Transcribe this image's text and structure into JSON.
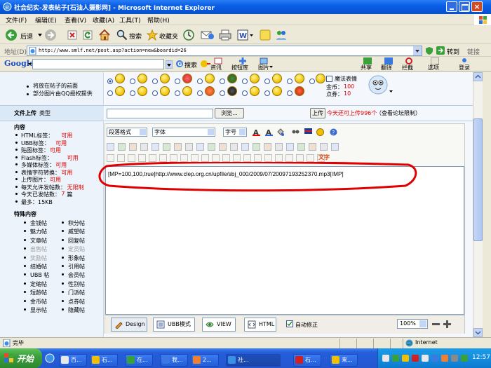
{
  "window": {
    "title": "社会纪实-发表帖子[石油人摄影网] - Microsoft Internet Explorer"
  },
  "menu": [
    "文件(F)",
    "编辑(E)",
    "查看(V)",
    "收藏(A)",
    "工具(T)",
    "帮助(H)"
  ],
  "toolbar": {
    "back": "后退",
    "search": "搜索",
    "favorites": "收藏夹"
  },
  "address": {
    "label": "地址(D)",
    "url": "http://www.smlf.net/post.asp?action=new&boardid=26",
    "go": "转到",
    "links": "链接"
  },
  "google": {
    "logo": "Google",
    "search": "搜索",
    "info": "资讯",
    "btn": "按钮库",
    "images": "图片",
    "share": "共享",
    "translate": "翻译",
    "block": "拦截",
    "options": "选项",
    "login": "登录"
  },
  "side_top": {
    "line1": "将放在帖子的前面",
    "line2": "部分图片由QQ授权提供"
  },
  "emoticon_opts": {
    "magic": "魔法表情",
    "coins_label": "金币：",
    "coins": "100",
    "points_label": "点券：",
    "points": "10"
  },
  "upload": {
    "label": "文件上传",
    "type": "类型",
    "browse": "浏览...",
    "upload_btn": "上传",
    "notice": "今天还可上传996个",
    "limit": "（查看论坛限制）"
  },
  "content": {
    "title": "内容",
    "items": [
      {
        "text": "HTML标签：",
        "value": "可用"
      },
      {
        "text": "UBB标签：",
        "value": "可用"
      },
      {
        "text": "贴图标签：",
        "value": "可用"
      },
      {
        "text": "Flash标签：",
        "value": "可用"
      },
      {
        "text": "多媒体标签：",
        "value": "可用"
      },
      {
        "text": "表情字符转换：",
        "value": "可用"
      },
      {
        "text": "上传图片：",
        "value": "可用"
      },
      {
        "text": "每天允许发帖数：",
        "value": "无限制"
      },
      {
        "text": "今天已发帖数：",
        "value": "7",
        "suffix": " 篇"
      },
      {
        "text": "最多：15KB",
        "value": ""
      }
    ]
  },
  "special": {
    "title": "特殊内容",
    "left": [
      "金钱帖",
      "魅力帖",
      "文章帖",
      "出售帖",
      "奖励帖",
      "结婚帖",
      "UBB 帖",
      "定缩帖",
      "短龄帖",
      "金币帖",
      "显示帖"
    ],
    "right": [
      "积分帖",
      "威望帖",
      "回复帖",
      "定员贴",
      "形象帖",
      "引用帖",
      "会员帖",
      "性别帖",
      "门派帖",
      "点券帖",
      "隐藏帖"
    ],
    "left_gray": [
      3,
      4
    ],
    "right_gray": [
      3
    ]
  },
  "editor": {
    "format": "段落格式",
    "font": "字体",
    "size": "字号",
    "body": "[MP=100,100,true]http://www.clep.org.cn/upfile/sbj_000/2009/07/20097193252370.mp3[/MP]",
    "text_label": "文字",
    "modes": {
      "design": "Design",
      "ubb": "UBB模式",
      "view": "VIEW",
      "html": "HTML",
      "auto": "自动修正"
    },
    "zoom": "100%"
  },
  "status": {
    "done": "完毕",
    "zone": "Internet"
  },
  "taskbar": {
    "start": "开始",
    "tasks": [
      "百...",
      "石...",
      "在...",
      "我...",
      "2...",
      "社...",
      "石...",
      "来..."
    ],
    "clock": "12:57"
  },
  "colors": {
    "titlebar": "#0a5fe6",
    "taskbar": "#245edb",
    "start": "#3c9e3c",
    "annotation": "#e00000"
  }
}
